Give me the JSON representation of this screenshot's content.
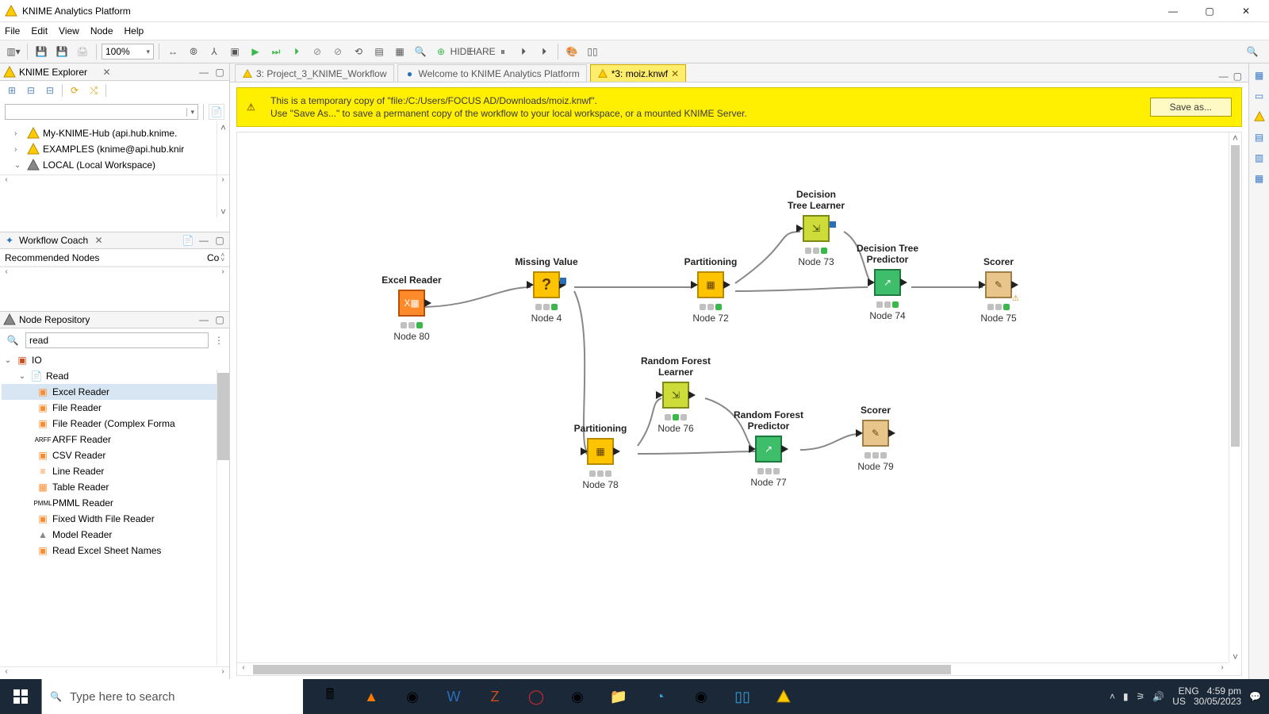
{
  "titlebar": {
    "title": "KNIME Analytics Platform"
  },
  "menu": {
    "file": "File",
    "edit": "Edit",
    "view": "View",
    "node": "Node",
    "help": "Help"
  },
  "toolbar": {
    "zoom": "100%"
  },
  "explorer": {
    "title": "KNIME Explorer",
    "items": [
      {
        "twisty": "›",
        "label": "My-KNIME-Hub (api.hub.knime."
      },
      {
        "twisty": "›",
        "label": "EXAMPLES (knime@api.hub.knir"
      },
      {
        "twisty": "⌄",
        "label": "LOCAL (Local Workspace)"
      }
    ]
  },
  "coach": {
    "title": "Workflow Coach",
    "col1": "Recommended Nodes",
    "col2": "Co"
  },
  "repo": {
    "title": "Node Repository",
    "search_value": "read",
    "tree": {
      "io": "IO",
      "read": "Read",
      "items": [
        "Excel Reader",
        "File Reader",
        "File Reader (Complex Forma",
        "ARFF Reader",
        "CSV Reader",
        "Line Reader",
        "Table Reader",
        "PMML Reader",
        "Fixed Width File Reader",
        "Model Reader",
        "Read Excel Sheet Names"
      ]
    }
  },
  "tabs": [
    {
      "label": "3: Project_3_KNIME_Workflow",
      "active": false
    },
    {
      "label": "Welcome to KNIME Analytics Platform",
      "active": false
    },
    {
      "label": "*3: moiz.knwf",
      "active": true
    }
  ],
  "banner": {
    "line1": "This is a temporary copy of \"file:/C:/Users/FOCUS AD/Downloads/moiz.knwf\".",
    "line2": "Use \"Save As...\" to save a permanent copy of the workflow to your local workspace, or a mounted KNIME Server.",
    "button": "Save as..."
  },
  "nodes": {
    "excel": {
      "label": "Excel Reader",
      "id": "Node 80",
      "glyph": "X▦"
    },
    "missing": {
      "label": "Missing Value",
      "id": "Node 4",
      "glyph": "?"
    },
    "part1": {
      "label": "Partitioning",
      "id": "Node 72",
      "glyph": "▦"
    },
    "dtl": {
      "label": "Decision\nTree Learner",
      "id": "Node 73",
      "glyph": "⇲"
    },
    "dtp": {
      "label": "Decision Tree\nPredictor",
      "id": "Node 74",
      "glyph": "↗"
    },
    "score1": {
      "label": "Scorer",
      "id": "Node 75",
      "glyph": "✎"
    },
    "part2": {
      "label": "Partitioning",
      "id": "Node 78",
      "glyph": "▦"
    },
    "rfl": {
      "label": "Random Forest\nLearner",
      "id": "Node 76",
      "glyph": "⇲"
    },
    "rfp": {
      "label": "Random Forest\nPredictor",
      "id": "Node 77",
      "glyph": "↗"
    },
    "score2": {
      "label": "Scorer",
      "id": "Node 79",
      "glyph": "✎"
    }
  },
  "task": {
    "search_placeholder": "Type here to search",
    "lang1": "ENG",
    "lang2": "US",
    "time": "4:59 pm",
    "date": "30/05/2023"
  }
}
